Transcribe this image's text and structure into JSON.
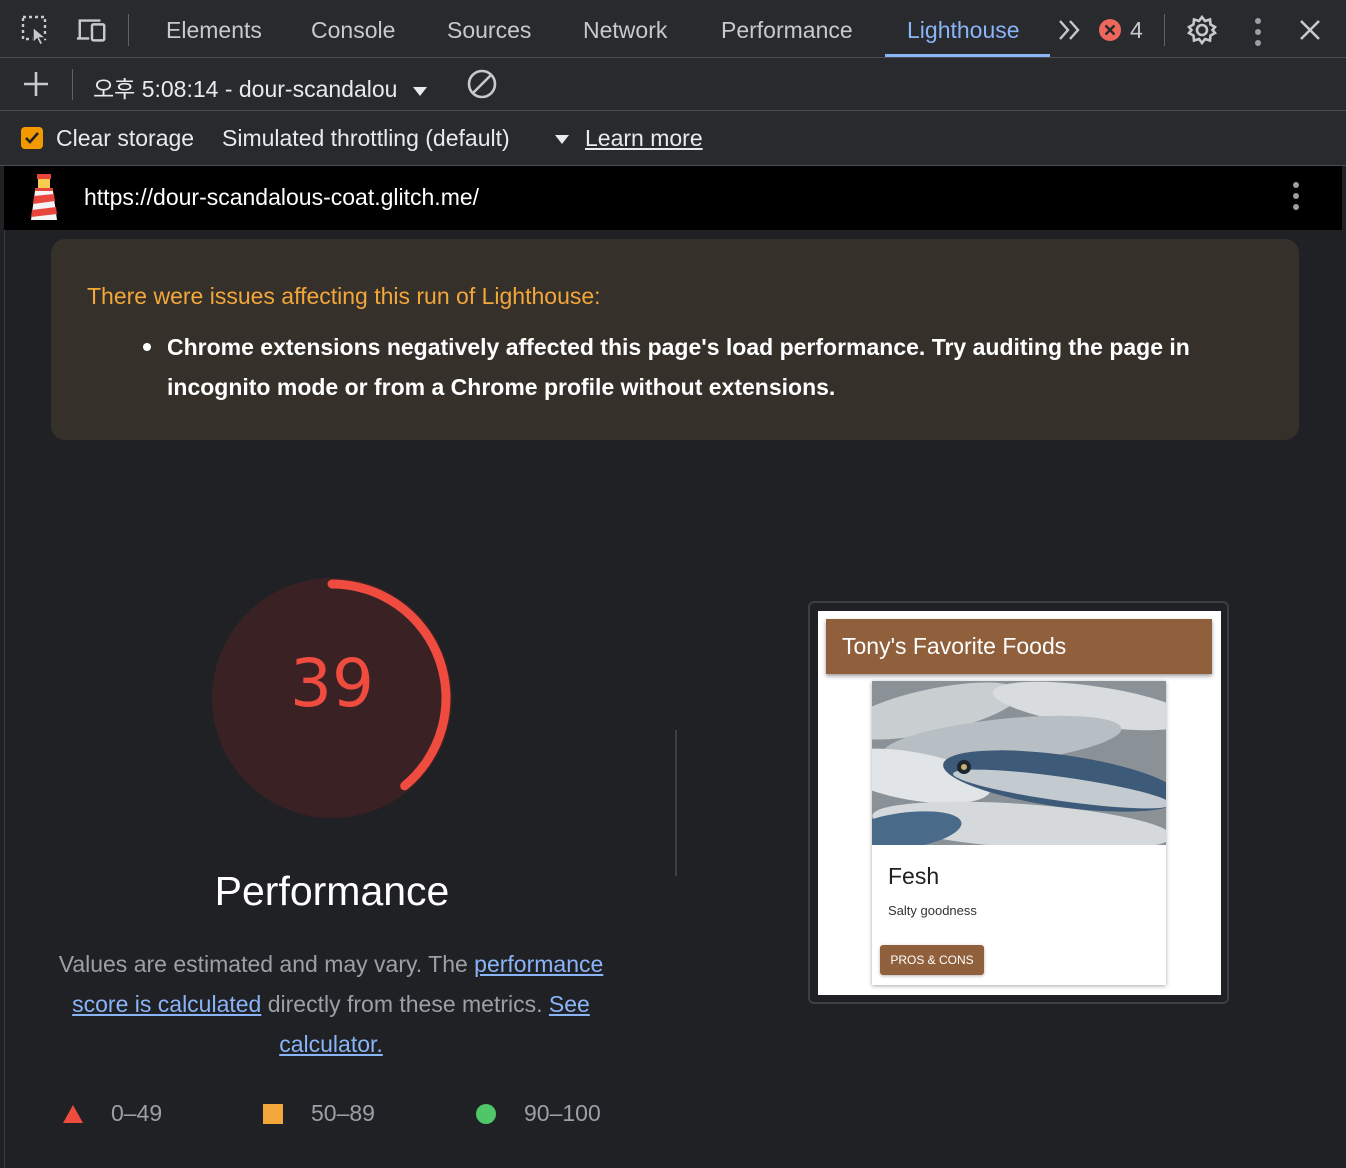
{
  "devtools": {
    "tabs": [
      "Elements",
      "Console",
      "Sources",
      "Network",
      "Performance",
      "Lighthouse"
    ],
    "active_tab": "Lighthouse",
    "error_count": "4",
    "accent_color": "#8ab4f8"
  },
  "toolbar": {
    "run_label": "오후 5:08:14 - dour-scandalou",
    "clear_storage_label": "Clear storage",
    "clear_storage_checked": true,
    "throttling_label": "Simulated throttling (default)",
    "learn_more_label": "Learn more"
  },
  "report": {
    "url": "https://dour-scandalous-coat.glitch.me/",
    "warning": {
      "title": "There were issues affecting this run of Lighthouse:",
      "items": [
        "Chrome extensions negatively affected this page's load performance. Try auditing the page in incognito mode or from a Chrome profile without extensions."
      ]
    },
    "score": "39",
    "score_fraction": 0.39,
    "score_color": "#ef4b3f",
    "category_title": "Performance",
    "description": {
      "pre": "Values are estimated and may vary. The ",
      "link1": "performance score is calculated",
      "mid": " directly from these metrics. ",
      "link2": "See calculator."
    },
    "legend": [
      {
        "range": "0–49",
        "shape": "triangle",
        "color": "#ef4b3f"
      },
      {
        "range": "50–89",
        "shape": "square",
        "color": "#f3a73b"
      },
      {
        "range": "90–100",
        "shape": "circle",
        "color": "#4fc667"
      }
    ]
  },
  "screenshot": {
    "header": "Tony's Favorite Foods",
    "card_title": "Fesh",
    "card_subtitle": "Salty goodness",
    "card_button": "PROS & CONS",
    "brand_color": "#905f3b"
  }
}
